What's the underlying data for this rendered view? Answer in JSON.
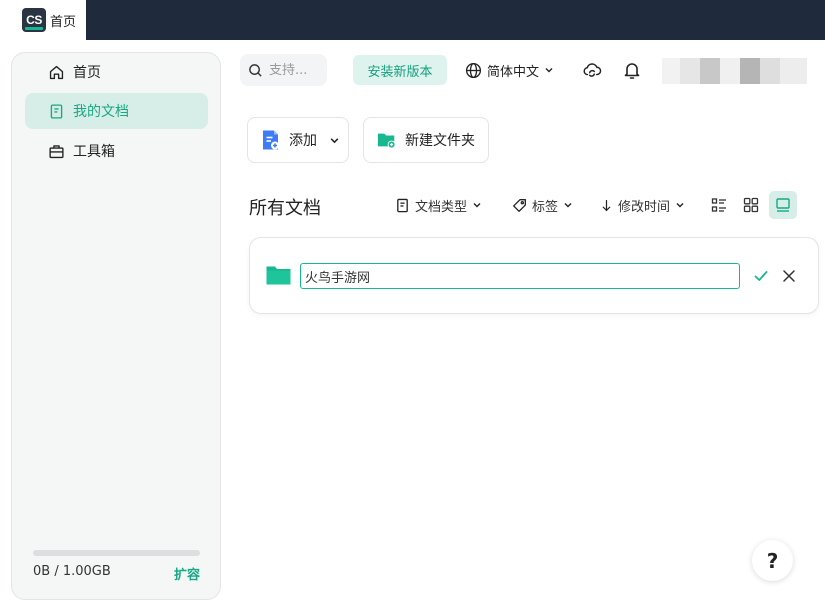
{
  "titlebar": {
    "tab_logo": "CS",
    "tab_title": "首页"
  },
  "sidebar": {
    "items": [
      {
        "label": "首页",
        "icon": "home-icon",
        "active": false
      },
      {
        "label": "我的文档",
        "icon": "document-icon",
        "active": true
      },
      {
        "label": "工具箱",
        "icon": "toolbox-icon",
        "active": false
      }
    ],
    "storage": {
      "text": "0B / 1.00GB",
      "used_fraction": 0,
      "expand_label": "扩容"
    }
  },
  "header": {
    "search_placeholder": "支持...",
    "install_label": "安装新版本",
    "language_label": "简体中文",
    "icons": [
      "cloud-sync-icon",
      "bell-icon"
    ]
  },
  "actions": {
    "add_label": "添加",
    "new_folder_label": "新建文件夹"
  },
  "content": {
    "title": "所有文档",
    "filters": {
      "doc_type": "文档类型",
      "tags": "标签",
      "modified": "修改时间"
    },
    "folder_name_value": "火鸟手游网"
  },
  "help_label": "?",
  "colors": {
    "accent": "#17b890",
    "titlebar": "#1f2a3d",
    "active_bg": "#d7eee8"
  }
}
